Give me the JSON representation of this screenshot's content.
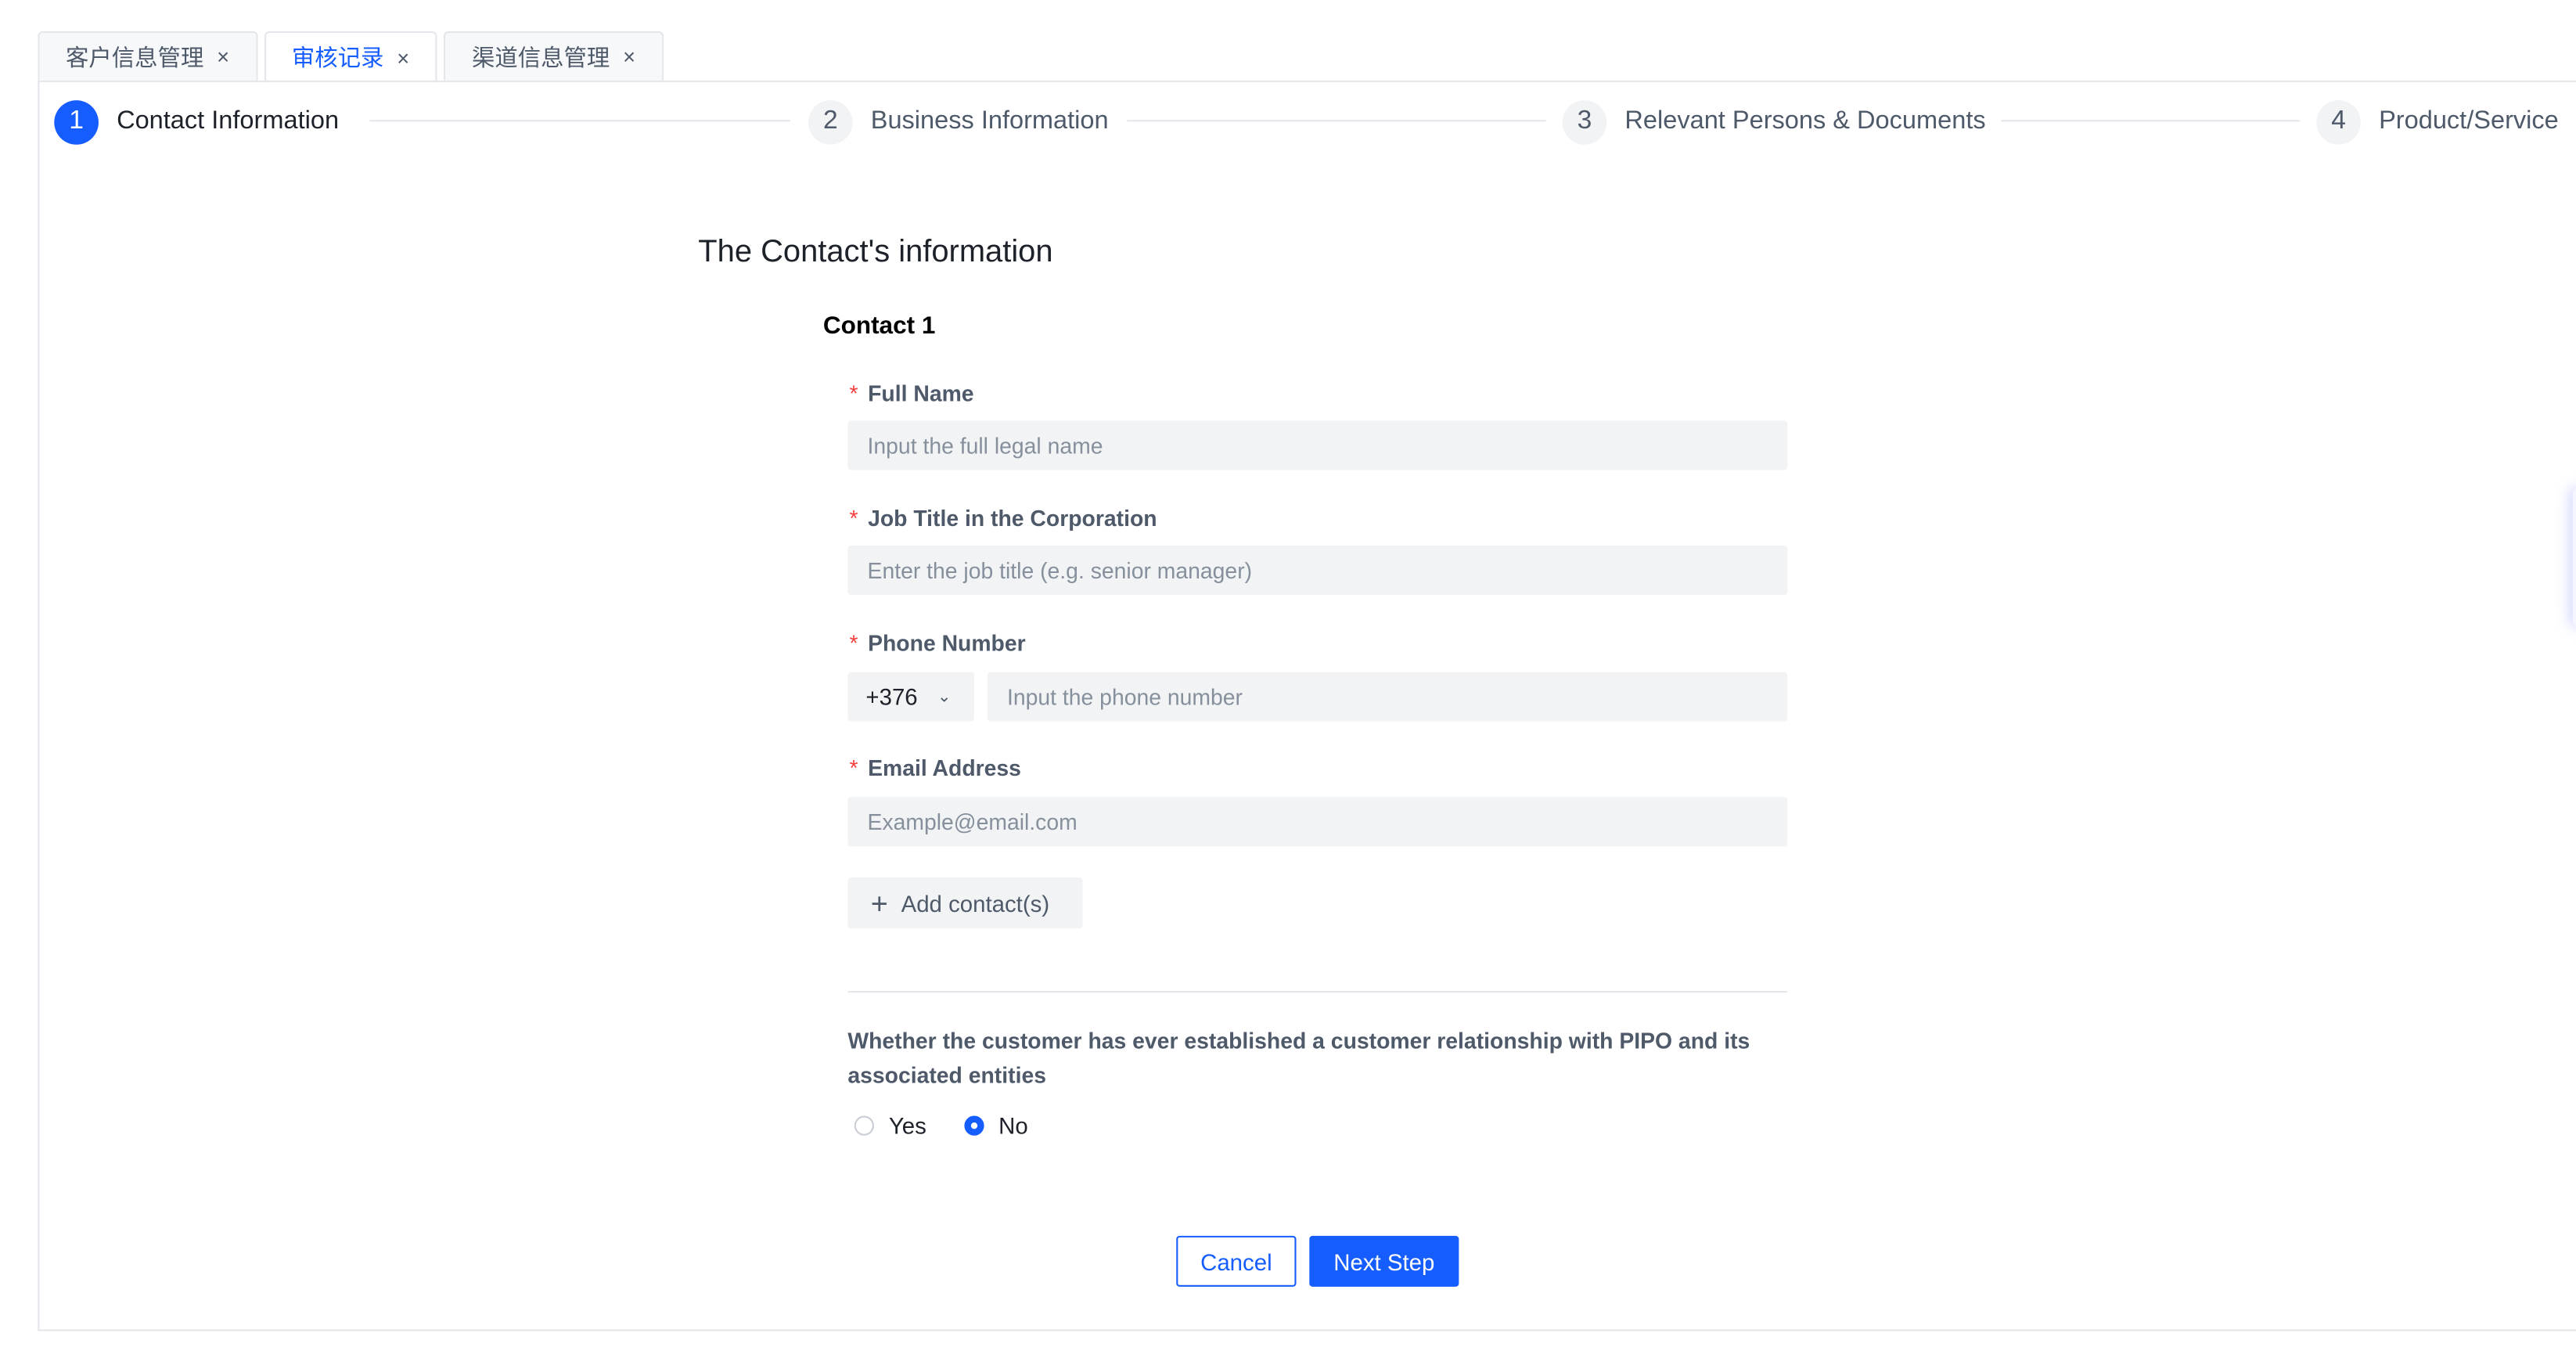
{
  "tabs": [
    {
      "label": "客户信息管理",
      "active": false
    },
    {
      "label": "审核记录",
      "active": true
    },
    {
      "label": "渠道信息管理",
      "active": false
    }
  ],
  "tab_close_glyph": "×",
  "steps": [
    {
      "number": "1",
      "label": "Contact Information",
      "active": true
    },
    {
      "number": "2",
      "label": "Business Information",
      "active": false
    },
    {
      "number": "3",
      "label": "Relevant Persons & Documents",
      "active": false
    },
    {
      "number": "4",
      "label": "Product/Service",
      "active": false
    }
  ],
  "form": {
    "title": "The Contact's information",
    "contact_heading": "Contact 1",
    "required_mark": "*",
    "fields": {
      "full_name": {
        "label": "Full Name",
        "placeholder": "Input the full legal name"
      },
      "job_title": {
        "label": "Job Title in the Corporation",
        "placeholder": "Enter the job title (e.g. senior manager)"
      },
      "phone": {
        "label": "Phone Number",
        "country_code": "+376",
        "placeholder": "Input the phone number"
      },
      "email": {
        "label": "Email Address",
        "placeholder": "Example@email.com"
      }
    },
    "add_contact_label": "Add contact(s)",
    "question": "Whether the customer has ever established a customer relationship with PIPO and its associated entities",
    "options": [
      {
        "label": "Yes",
        "selected": false
      },
      {
        "label": "No",
        "selected": true
      }
    ]
  },
  "actions": {
    "cancel": "Cancel",
    "next": "Next Step"
  },
  "colors": {
    "primary": "#165dff",
    "required": "#f53f3f",
    "input_bg": "#f2f3f5"
  }
}
